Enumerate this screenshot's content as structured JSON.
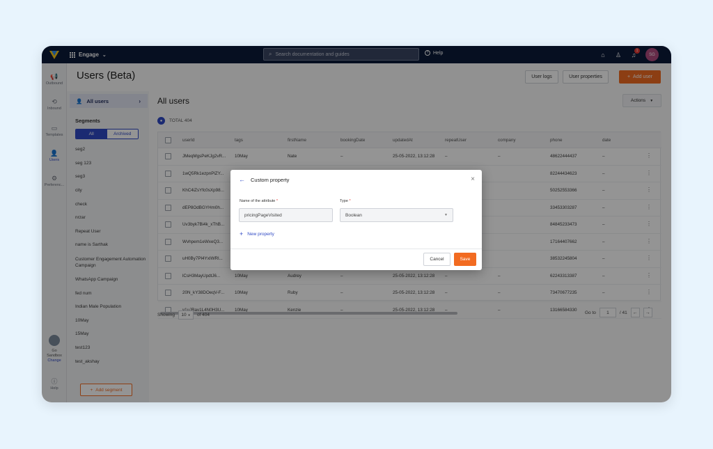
{
  "topbar": {
    "app_name": "Engage",
    "search_placeholder": "Search documentation and guides",
    "help_label": "Help",
    "notification_count": "1",
    "avatar_initials": "SG"
  },
  "leftnav": {
    "items": [
      {
        "label": "Outbound",
        "icon": "megaphone-icon"
      },
      {
        "label": "Inbound",
        "icon": "inbound-icon"
      },
      {
        "label": "Templates",
        "icon": "templates-icon"
      },
      {
        "label": "Users",
        "icon": "users-icon"
      },
      {
        "label": "Preferenc...",
        "icon": "gear-icon"
      }
    ],
    "profile_name": "Go Sandbox",
    "profile_change": "Change",
    "help_label": "Help"
  },
  "page": {
    "title": "Users (Beta)",
    "user_logs": "User logs",
    "user_properties": "User properties",
    "add_user": "Add user"
  },
  "segments": {
    "all_users": "All users",
    "heading": "Segments",
    "tab_all": "All",
    "tab_archived": "Archived",
    "items": [
      "seg2",
      "seg 123",
      "seg3",
      "city",
      "check",
      "nrzar",
      "Repeat User",
      "name is Sarthak",
      "Customer Engagement Automation Campaign",
      "WhatsApp Campaign",
      "fed num",
      "Indian Male Population",
      "10May",
      "15May",
      "test123",
      "test_akshay"
    ],
    "add_segment": "Add segment"
  },
  "main": {
    "title": "All users",
    "actions": "Actions",
    "total": "TOTAL 404",
    "columns": [
      "userId",
      "tags",
      "firstName",
      "bookingDate",
      "updatedAt",
      "repeatUser",
      "company",
      "phone",
      "date"
    ],
    "rows": [
      [
        "JMeqMgsPeKJg2vR...",
        "10May",
        "Nate",
        "–",
        "25-05-2022, 13:12:28",
        "–",
        "–",
        "48622444437",
        "–"
      ],
      [
        "1wQ5Rk1ezpnPlZY...",
        "",
        "",
        "",
        "",
        "",
        "",
        "82244434623",
        "–"
      ],
      [
        "KhC4iZsYfc0sXp98...",
        "",
        "",
        "",
        "",
        "",
        "",
        "50252553366",
        "–"
      ],
      [
        "dEP8OdBGYHm0h...",
        "",
        "",
        "",
        "",
        "",
        "",
        "33453303287",
        "–"
      ],
      [
        "Uv3byk7Bi4k_xThB...",
        "",
        "",
        "",
        "",
        "",
        "",
        "84845233473",
        "–"
      ],
      [
        "Wvhpem1eWxeQ3...",
        "",
        "",
        "",
        "",
        "",
        "",
        "17164407662",
        "–"
      ],
      [
        "uH0By7Pl4YxIWRl...",
        "",
        "",
        "",
        "",
        "",
        "",
        "38532245804",
        "–"
      ],
      [
        "lCsH3MayUpdtJ6...",
        "10May",
        "Audrey",
        "–",
        "25-05-2022, 13:12:28",
        "–",
        "–",
        "62243313387",
        "–"
      ],
      [
        "20N_kY38DOeqV-F...",
        "10May",
        "Ruby",
        "–",
        "25-05-2022, 13:12:28",
        "–",
        "–",
        "73470677235",
        "–"
      ],
      [
        "y1uJBav1L4N0H3U...",
        "10May",
        "Kenzie",
        "–",
        "25-05-2022, 13:12:28",
        "–",
        "–",
        "13166584330",
        "–"
      ]
    ],
    "showing": "Showing",
    "page_size": "10",
    "of_total": "of 404",
    "goto": "Go to",
    "page_num": "1",
    "page_total": "/ 41"
  },
  "modal": {
    "title": "Custom property",
    "name_label": "Name of the attribute",
    "name_value": "pricingPageVisited",
    "type_label": "Type",
    "type_value": "Boolean",
    "new_property": "New property",
    "cancel": "Cancel",
    "save": "Save"
  },
  "colors": {
    "accent": "#f26b21",
    "brand_blue": "#2f49c4",
    "topbar": "#0c1a3a"
  }
}
